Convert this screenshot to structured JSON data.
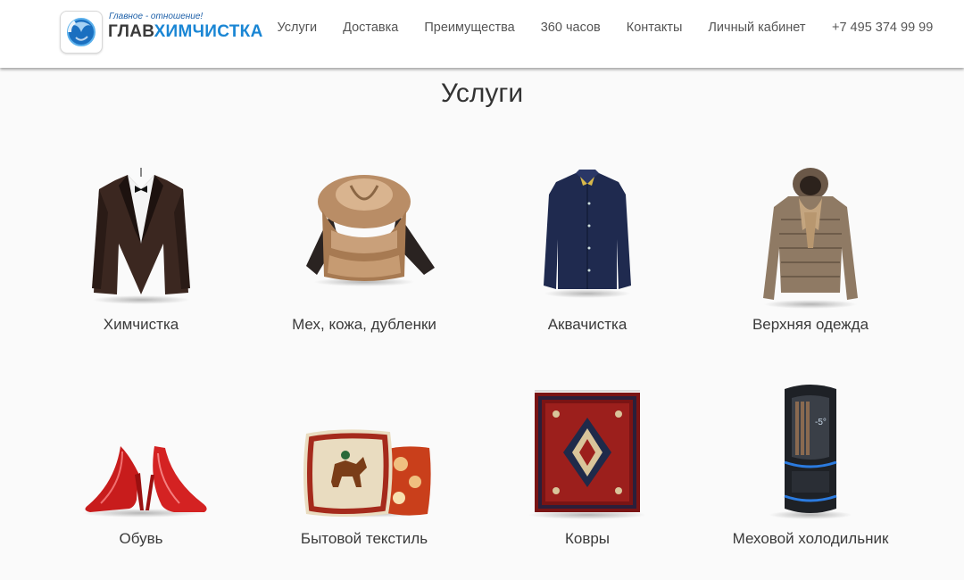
{
  "header": {
    "logo": {
      "tagline": "Главное - отношение!",
      "name_part1": "ГЛАВ",
      "name_part2": "ХИМЧИСТКА"
    },
    "nav": [
      {
        "label": "Услуги"
      },
      {
        "label": "Доставка"
      },
      {
        "label": "Преимущества"
      },
      {
        "label": "360 часов"
      },
      {
        "label": "Контакты"
      },
      {
        "label": "Личный кабинет"
      }
    ],
    "phone": "+7 495 374 99 99"
  },
  "page_title": "Услуги",
  "services": [
    {
      "label": "Химчистка",
      "icon": "suit-icon"
    },
    {
      "label": "Мех, кожа, дубленки",
      "icon": "fur-coat-icon"
    },
    {
      "label": "Аквачистка",
      "icon": "shirt-icon"
    },
    {
      "label": "Верхняя одежда",
      "icon": "down-jacket-icon"
    },
    {
      "label": "Обувь",
      "icon": "shoes-icon"
    },
    {
      "label": "Бытовой текстиль",
      "icon": "pillows-icon"
    },
    {
      "label": "Ковры",
      "icon": "carpet-icon"
    },
    {
      "label": "Меховой холодильник",
      "icon": "fur-fridge-icon"
    }
  ],
  "colors": {
    "brand_blue": "#1a86d4",
    "tagline_blue": "#1c5fa8",
    "background": "#fafafa"
  }
}
